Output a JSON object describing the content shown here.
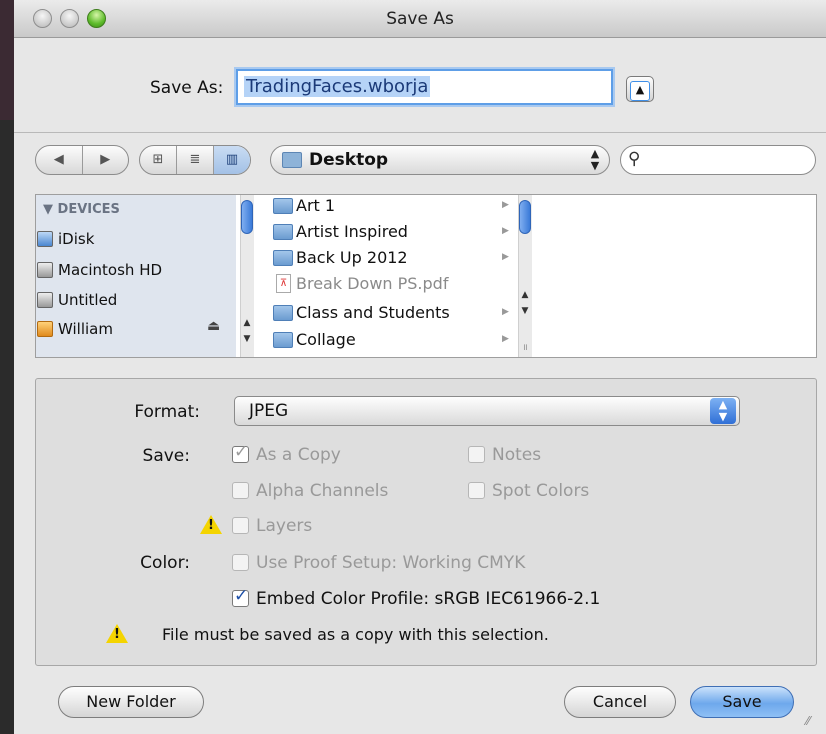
{
  "window": {
    "title": "Save As"
  },
  "save_as": {
    "label": "Save As:",
    "filename": "TradingFaces.wborja",
    "disclosure_glyph": "▲"
  },
  "toolbar": {
    "back": "◀",
    "forward": "▶",
    "icon_view": "⊞",
    "list_view": "≣",
    "column_view": "▥",
    "location": "Desktop",
    "search_placeholder": ""
  },
  "sidebar": {
    "header": "DEVICES",
    "items": [
      {
        "label": "iDisk"
      },
      {
        "label": "Macintosh HD"
      },
      {
        "label": "Untitled"
      },
      {
        "label": "William"
      }
    ]
  },
  "files": [
    {
      "name": "Art 1",
      "type": "folder"
    },
    {
      "name": "Artist Inspired",
      "type": "folder"
    },
    {
      "name": "Back Up 2012",
      "type": "folder"
    },
    {
      "name": "Break Down PS.pdf",
      "type": "pdf"
    },
    {
      "name": "Class and Students",
      "type": "folder"
    },
    {
      "name": "Collage",
      "type": "folder"
    }
  ],
  "options": {
    "format_label": "Format:",
    "format_value": "JPEG",
    "save_label": "Save:",
    "as_a_copy": "As a Copy",
    "notes": "Notes",
    "alpha_channels": "Alpha Channels",
    "spot_colors": "Spot Colors",
    "layers": "Layers",
    "color_label": "Color:",
    "use_proof_setup": "Use Proof Setup:  Working CMYK",
    "embed_color_profile": "Embed Color Profile:  sRGB IEC61966-2.1",
    "warning_note": "File must be saved as a copy with this selection.",
    "warning_glyph": "!"
  },
  "buttons": {
    "new_folder": "New Folder",
    "cancel": "Cancel",
    "save": "Save"
  }
}
